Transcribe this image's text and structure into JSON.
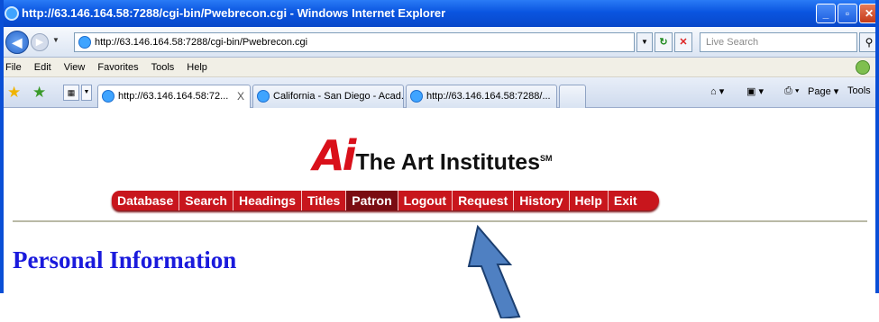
{
  "window": {
    "title": "http://63.146.164.58:7288/cgi-bin/Pwebrecon.cgi - Windows Internet Explorer",
    "buttons": [
      "_",
      "▫",
      "✕"
    ]
  },
  "address_bar": {
    "url": "http://63.146.164.58:7288/cgi-bin/Pwebrecon.cgi",
    "search_placeholder": "Live Search"
  },
  "menu": [
    "File",
    "Edit",
    "View",
    "Favorites",
    "Tools",
    "Help"
  ],
  "tabs": [
    {
      "label": "http://63.146.164.58:72...",
      "active": true,
      "close": "X"
    },
    {
      "label": "California - San Diego - Acad...",
      "active": false
    },
    {
      "label": "http://63.146.164.58:7288/...",
      "active": false
    }
  ],
  "command_bar": {
    "page": "Page",
    "tools": "Tools"
  },
  "page": {
    "logo_mark": "Ai",
    "logo_text": "The Art Institutes",
    "logo_sm": "SM",
    "nav": [
      "Database",
      "Search",
      "Headings",
      "Titles",
      "Patron",
      "Logout",
      "Request",
      "History",
      "Help",
      "Exit"
    ],
    "nav_selected": "Patron",
    "heading": "Personal Information"
  },
  "colors": {
    "nav_red": "#c8161d",
    "nav_selected": "#7a0c12",
    "heading_blue": "#1a1adc",
    "arrow_blue": "#4f80c2"
  },
  "icons": {
    "favorites": "star-icon",
    "add_favorite": "add-favorite-icon",
    "home": "home-icon",
    "feeds": "feeds-icon",
    "print": "print-icon"
  }
}
